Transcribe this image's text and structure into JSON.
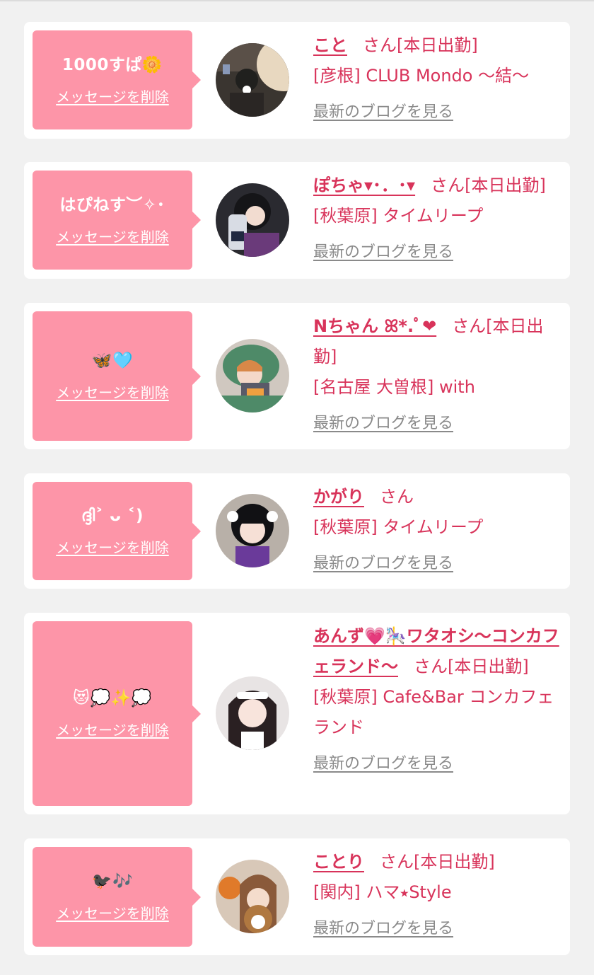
{
  "delete_label": "メッセージを削除",
  "blog_label": "最新のブログを見る",
  "san_label": "さん",
  "work_badge": "[本日出勤]",
  "colors": {
    "page_bg": "#f1f1f1",
    "card_bg": "#ffffff",
    "bubble_bg": "#fd95a8",
    "accent": "#d8335a",
    "link_gray": "#8a8a8a"
  },
  "entries": [
    {
      "message": "1000すぱ🌼",
      "name": "こと",
      "badge": "[本日出勤]",
      "shop": "[彦根] CLUB Mondo 〜結〜",
      "avatar_icon": "girl-photo-avatar"
    },
    {
      "message": "はぴねす︶✧･",
      "name": "ぽちゃ▾･．･▾",
      "badge": "[本日出勤]",
      "shop": "[秋葉原] タイムリープ",
      "avatar_icon": "girl-photo-avatar"
    },
    {
      "message": "🦋🩵",
      "name": "Nちゃん ꕤ*.ﾟ❤",
      "badge": "[本日出勤]",
      "shop": "[名古屋 大曽根] with",
      "avatar_icon": "girl-photo-avatar"
    },
    {
      "message": "ദ്ദി˃ ᴗ ˂)",
      "name": "かがり",
      "badge": "",
      "shop": "[秋葉原] タイムリープ",
      "avatar_icon": "girl-photo-avatar"
    },
    {
      "message": "😻💭✨💭",
      "name": "あんず💗🎠ワタオシ〜コンカフェランド〜",
      "badge": "[本日出勤]",
      "shop": "[秋葉原] Cafe&Bar コンカフェランド",
      "avatar_icon": "girl-photo-avatar"
    },
    {
      "message": "🐦‍⬛🎶",
      "name": "ことり",
      "badge": "[本日出勤]",
      "shop": "[関内] ハマ⭑Style",
      "avatar_icon": "girl-photo-avatar"
    }
  ]
}
